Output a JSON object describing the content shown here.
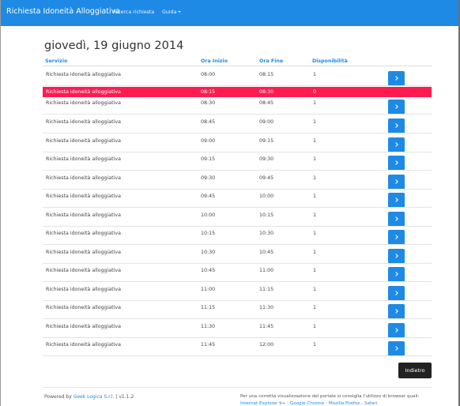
{
  "navbar": {
    "brand": "Richiesta Idoneità Alloggiativa",
    "links": [
      "Ricerca richiesta",
      "Guida"
    ]
  },
  "page": {
    "title": "giovedì, 19 giugno 2014"
  },
  "table": {
    "headers": [
      "Servizio",
      "Ora Inizio",
      "Ora Fine",
      "Disponibilità"
    ],
    "rows": [
      {
        "servizio": "Richiesta idoneità alloggiativa",
        "inizio": "08:00",
        "fine": "08:15",
        "disp": "1",
        "full": false
      },
      {
        "servizio": "Richiesta idoneità alloggiativa",
        "inizio": "08:15",
        "fine": "08:30",
        "disp": "0",
        "full": true
      },
      {
        "servizio": "Richiesta idoneità alloggiativa",
        "inizio": "08:30",
        "fine": "08:45",
        "disp": "1",
        "full": false
      },
      {
        "servizio": "Richiesta idoneità alloggiativa",
        "inizio": "08:45",
        "fine": "09:00",
        "disp": "1",
        "full": false
      },
      {
        "servizio": "Richiesta idoneità alloggiativa",
        "inizio": "09:00",
        "fine": "09:15",
        "disp": "1",
        "full": false
      },
      {
        "servizio": "Richiesta idoneità alloggiativa",
        "inizio": "09:15",
        "fine": "09:30",
        "disp": "1",
        "full": false
      },
      {
        "servizio": "Richiesta idoneità alloggiativa",
        "inizio": "09:30",
        "fine": "09:45",
        "disp": "1",
        "full": false
      },
      {
        "servizio": "Richiesta idoneità alloggiativa",
        "inizio": "09:45",
        "fine": "10:00",
        "disp": "1",
        "full": false
      },
      {
        "servizio": "Richiesta idoneità alloggiativa",
        "inizio": "10:00",
        "fine": "10:15",
        "disp": "1",
        "full": false
      },
      {
        "servizio": "Richiesta idoneità alloggiativa",
        "inizio": "10:15",
        "fine": "10:30",
        "disp": "1",
        "full": false
      },
      {
        "servizio": "Richiesta idoneità alloggiativa",
        "inizio": "10:30",
        "fine": "10:45",
        "disp": "1",
        "full": false
      },
      {
        "servizio": "Richiesta idoneità alloggiativa",
        "inizio": "10:45",
        "fine": "11:00",
        "disp": "1",
        "full": false
      },
      {
        "servizio": "Richiesta idoneità alloggiativa",
        "inizio": "11:00",
        "fine": "11:15",
        "disp": "1",
        "full": false
      },
      {
        "servizio": "Richiesta idoneità alloggiativa",
        "inizio": "11:15",
        "fine": "11:30",
        "disp": "1",
        "full": false
      },
      {
        "servizio": "Richiesta idoneità alloggiativa",
        "inizio": "11:30",
        "fine": "11:45",
        "disp": "1",
        "full": false
      },
      {
        "servizio": "Richiesta idoneità alloggiativa",
        "inizio": "11:45",
        "fine": "12:00",
        "disp": "1",
        "full": false
      }
    ]
  },
  "back_button": "Indietro",
  "footer": {
    "powered": "Powered by ",
    "company": "Geek Logica S.r.l.",
    "version": " | v1.1.2",
    "note": "Per una corretta visualizzazione del portale si consiglia l'utilizzo di browser quali:",
    "browsers": "Internet Explorer 9+ - Google Chrome - Mozilla Firefox - Safari"
  },
  "colors": {
    "primary": "#1e8ae6",
    "full_row": "#ff1a4f",
    "dark_button": "#222222"
  }
}
